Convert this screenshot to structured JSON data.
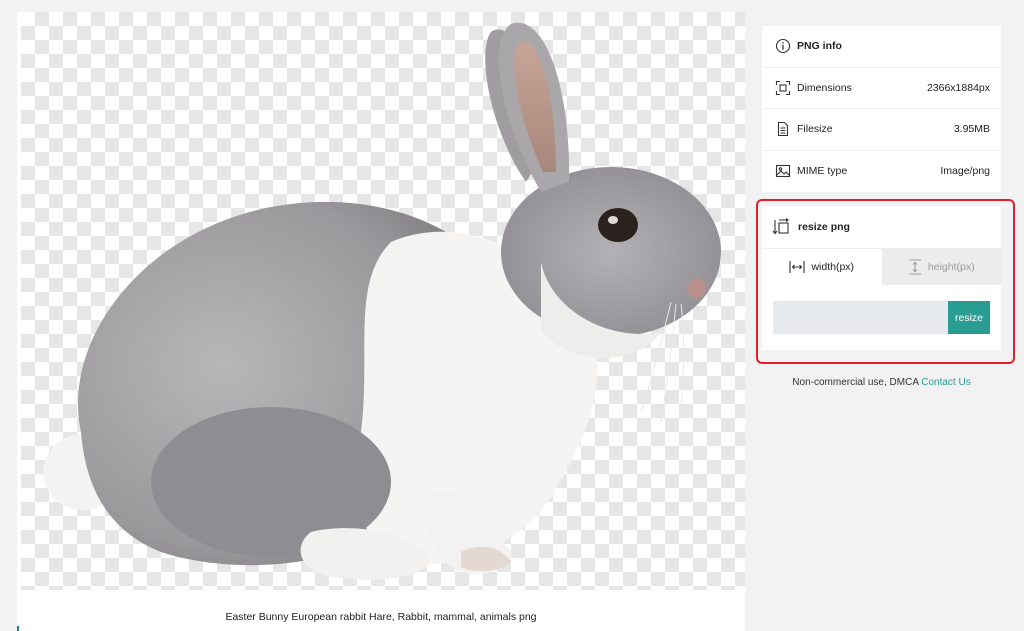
{
  "image": {
    "caption": "Easter Bunny European rabbit Hare, Rabbit, mammal, animals png"
  },
  "info": {
    "title": "PNG info",
    "title_icon": "info-icon",
    "rows": [
      {
        "label": "Dimensions",
        "value": "2366x1884px",
        "icon": "dimensions-icon"
      },
      {
        "label": "Filesize",
        "value": "3.95MB",
        "icon": "file-icon"
      },
      {
        "label": "MIME type",
        "value": "Image/png",
        "icon": "image-icon"
      }
    ]
  },
  "resize": {
    "title": "resize png",
    "icon": "resize-icon",
    "tabs": [
      {
        "label": "width(px)",
        "icon": "width-arrows-icon",
        "active": true
      },
      {
        "label": "height(px)",
        "icon": "height-arrows-icon",
        "active": false
      }
    ],
    "input_value": "",
    "button_label": "resize"
  },
  "footer": {
    "text": "Non-commercial use, DMCA",
    "link_label": "Contact Us"
  },
  "colors": {
    "accent": "#2a9d93",
    "highlight_outline": "#e0202e"
  }
}
